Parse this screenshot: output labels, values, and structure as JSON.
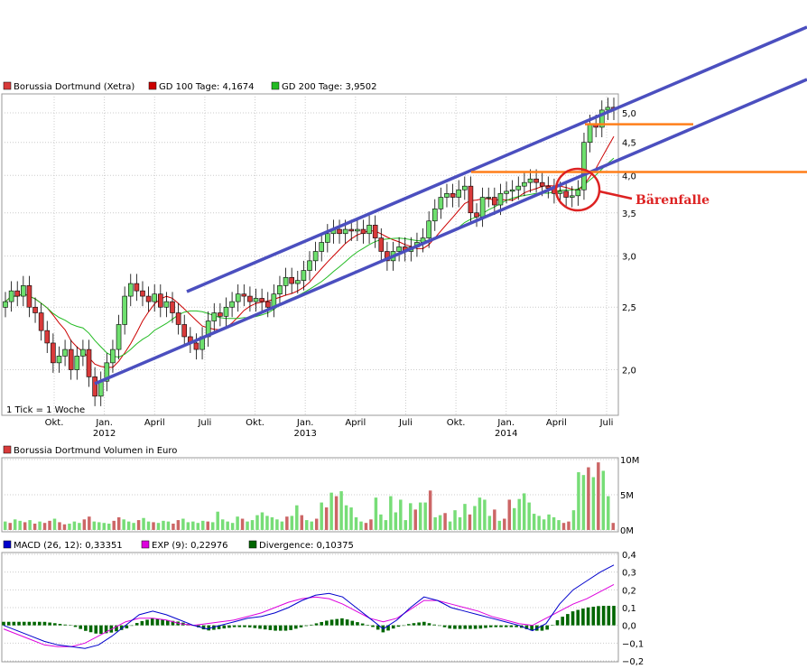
{
  "colors": {
    "stock": "#d93a3a",
    "gd100": "#cc0000",
    "gd200": "#22bb22",
    "channel": "#4b4fbf",
    "resistance": "#ff7f1a",
    "annotation": "#dd2222",
    "macd": "#0000cc",
    "exp": "#dd00dd",
    "divergence": "#006600",
    "volume_up": "#77dd77",
    "volume_down": "#cc6666",
    "grid": "#cccccc"
  },
  "chart_data": [
    {
      "id": "price",
      "type": "candlestick",
      "legend": [
        {
          "label": "Borussia Dortmund (Xetra)",
          "color": "#d93a3a"
        },
        {
          "label": "GD 100 Tage: 4,1674",
          "color": "#cc0000"
        },
        {
          "label": "GD 200 Tage: 3,9502",
          "color": "#22bb22"
        }
      ],
      "scale": "log",
      "ylim": [
        1.7,
        5.35
      ],
      "yticks": [
        "2,0",
        "2,5",
        "3,0",
        "3,5",
        "4,0",
        "4,5",
        "5,0"
      ],
      "ytick_values": [
        2.0,
        2.5,
        3.0,
        3.5,
        4.0,
        4.5,
        5.0
      ],
      "xlabels": [
        "Okt.",
        "Jan.",
        "April",
        "Juli",
        "Okt.",
        "Jan.",
        "April",
        "Juli",
        "Okt.",
        "Jan.",
        "April",
        "Juli"
      ],
      "xlabels_sub": [
        "",
        "2012",
        "",
        "",
        "",
        "2013",
        "",
        "",
        "",
        "2014",
        "",
        ""
      ],
      "xrange": [
        "2011-08",
        "2014-07"
      ],
      "note": "1 Tick = 1 Woche",
      "annotation": "Bärenfalle",
      "weekly_close": [
        2.55,
        2.65,
        2.6,
        2.7,
        2.5,
        2.45,
        2.3,
        2.2,
        2.05,
        2.1,
        2.15,
        2.0,
        2.1,
        2.15,
        1.95,
        1.82,
        1.92,
        2.05,
        2.15,
        2.35,
        2.6,
        2.72,
        2.65,
        2.6,
        2.55,
        2.62,
        2.5,
        2.55,
        2.45,
        2.35,
        2.25,
        2.2,
        2.15,
        2.25,
        2.38,
        2.45,
        2.42,
        2.5,
        2.55,
        2.62,
        2.6,
        2.55,
        2.58,
        2.55,
        2.5,
        2.62,
        2.7,
        2.78,
        2.72,
        2.75,
        2.85,
        2.95,
        3.05,
        3.15,
        3.25,
        3.3,
        3.25,
        3.3,
        3.28,
        3.3,
        3.25,
        3.35,
        3.2,
        3.05,
        2.95,
        3.05,
        3.1,
        3.05,
        3.1,
        3.15,
        3.2,
        3.4,
        3.55,
        3.7,
        3.75,
        3.7,
        3.8,
        3.85,
        3.5,
        3.45,
        3.7,
        3.7,
        3.6,
        3.75,
        3.78,
        3.8,
        3.85,
        3.9,
        3.95,
        3.9,
        3.85,
        3.82,
        3.75,
        3.78,
        3.7,
        3.72,
        3.8,
        4.5,
        4.8,
        4.75,
        5.05,
        5.1,
        5.05
      ],
      "channel": {
        "upper": [
          [
            "2012-06",
            2.62
          ],
          [
            "2014-07",
            5.05
          ]
        ],
        "lower": [
          [
            "2011-12",
            1.75
          ],
          [
            "2014-07",
            4.0
          ]
        ],
        "outer_upper_note": "extends beyond plot area to the right"
      },
      "resistance": [
        4.8,
        4.05
      ]
    },
    {
      "id": "volume",
      "type": "bar",
      "legend": [
        {
          "label": "Borussia Dortmund Volumen in Euro",
          "color": "#d93a3a"
        }
      ],
      "yticks": [
        "10M",
        "5M",
        "0M"
      ],
      "ytick_values": [
        10,
        5,
        0
      ],
      "ylim": [
        0,
        10
      ],
      "unit": "M Euro",
      "values": [
        1.2,
        1.0,
        1.5,
        1.3,
        1.1,
        1.4,
        0.9,
        1.2,
        1.0,
        1.3,
        1.6,
        1.1,
        0.8,
        0.9,
        1.2,
        1.0,
        1.5,
        1.9,
        1.2,
        1.1,
        1.0,
        0.9,
        1.3,
        1.8,
        1.5,
        1.2,
        1.0,
        1.4,
        1.7,
        1.2,
        1.1,
        1.0,
        1.3,
        1.2,
        0.9,
        1.4,
        1.6,
        1.1,
        1.2,
        1.0,
        1.3,
        1.2,
        1.1,
        2.6,
        1.5,
        1.2,
        1.0,
        1.9,
        1.6,
        1.2,
        1.4,
        2.1,
        2.5,
        2.0,
        1.8,
        1.5,
        1.2,
        1.9,
        2.0,
        3.5,
        2.1,
        1.4,
        1.2,
        1.6,
        3.9,
        3.2,
        5.3,
        4.8,
        5.5,
        3.5,
        3.2,
        1.8,
        1.2,
        1.0,
        1.5,
        4.6,
        2.2,
        1.4,
        4.8,
        2.5,
        4.3,
        1.4,
        3.8,
        2.9,
        3.9,
        3.9,
        5.6,
        1.8,
        2.1,
        2.4,
        1.2,
        2.8,
        1.8,
        3.7,
        2.2,
        3.4,
        4.6,
        4.3,
        2.0,
        2.9,
        1.3,
        1.6,
        4.3,
        3.1,
        4.4,
        5.2,
        3.9,
        2.3,
        2.0,
        1.5,
        2.2,
        1.8,
        1.4,
        1.0,
        1.2,
        2.8,
        8.2,
        7.8,
        8.9,
        7.5,
        9.6,
        8.4,
        4.8,
        1.0
      ],
      "up": [
        1,
        0,
        1,
        1,
        0,
        1,
        0,
        1,
        0,
        0,
        1,
        0,
        0,
        1,
        1,
        1,
        0,
        0,
        1,
        1,
        1,
        1,
        0,
        0,
        1,
        1,
        1,
        0,
        1,
        1,
        0,
        1,
        1,
        1,
        0,
        0,
        1,
        1,
        1,
        1,
        1,
        0,
        1,
        1,
        1,
        1,
        1,
        1,
        0,
        1,
        1,
        1,
        1,
        1,
        1,
        1,
        1,
        0,
        1,
        1,
        0,
        1,
        1,
        0,
        1,
        0,
        1,
        0,
        1,
        1,
        1,
        1,
        1,
        0,
        0,
        1,
        1,
        1,
        1,
        1,
        1,
        1,
        1,
        0,
        1,
        1,
        0,
        1,
        1,
        0,
        1,
        1,
        1,
        1,
        0,
        1,
        1,
        1,
        1,
        0,
        1,
        0,
        0,
        1,
        1,
        1,
        1,
        1,
        1,
        1,
        1,
        1,
        1,
        0,
        0,
        1,
        1,
        1,
        0,
        1,
        0,
        1,
        1,
        0
      ]
    },
    {
      "id": "macd",
      "type": "line+bar",
      "legend": [
        {
          "label": "MACD (26, 12): 0,33351",
          "color": "#0000cc"
        },
        {
          "label": "EXP (9): 0,22976",
          "color": "#dd00dd"
        },
        {
          "label": "Divergence: 0,10375",
          "color": "#006600"
        }
      ],
      "yticks": [
        "0,4",
        "0,3",
        "0,2",
        "0,1",
        "0,0",
        "−0,1",
        "−0,2"
      ],
      "ytick_values": [
        0.4,
        0.3,
        0.2,
        0.1,
        0.0,
        -0.1,
        -0.2
      ],
      "ylim": [
        -0.2,
        0.4
      ],
      "macd": [
        0.0,
        -0.03,
        -0.06,
        -0.09,
        -0.11,
        -0.12,
        -0.13,
        -0.11,
        -0.06,
        0.0,
        0.06,
        0.08,
        0.06,
        0.03,
        0.0,
        -0.02,
        0.0,
        0.02,
        0.04,
        0.05,
        0.07,
        0.1,
        0.14,
        0.17,
        0.18,
        0.16,
        0.1,
        0.04,
        -0.02,
        0.03,
        0.1,
        0.16,
        0.14,
        0.1,
        0.08,
        0.06,
        0.04,
        0.02,
        0.0,
        -0.03,
        0.01,
        0.12
      ],
      "exp": [
        -0.02,
        -0.05,
        -0.08,
        -0.11,
        -0.12,
        -0.12,
        -0.1,
        -0.06,
        -0.02,
        0.02,
        0.04,
        0.04,
        0.03,
        0.01,
        0.0,
        0.01,
        0.02,
        0.03,
        0.05,
        0.07,
        0.1,
        0.13,
        0.15,
        0.16,
        0.15,
        0.12,
        0.08,
        0.04,
        0.02,
        0.04,
        0.09,
        0.14,
        0.14,
        0.12,
        0.1,
        0.08,
        0.05,
        0.03,
        0.01,
        0.0,
        0.04,
        0.08
      ],
      "macd_end": [
        0.2,
        0.25,
        0.3,
        0.34
      ],
      "exp_end": [
        0.12,
        0.15,
        0.19,
        0.23
      ]
    }
  ]
}
